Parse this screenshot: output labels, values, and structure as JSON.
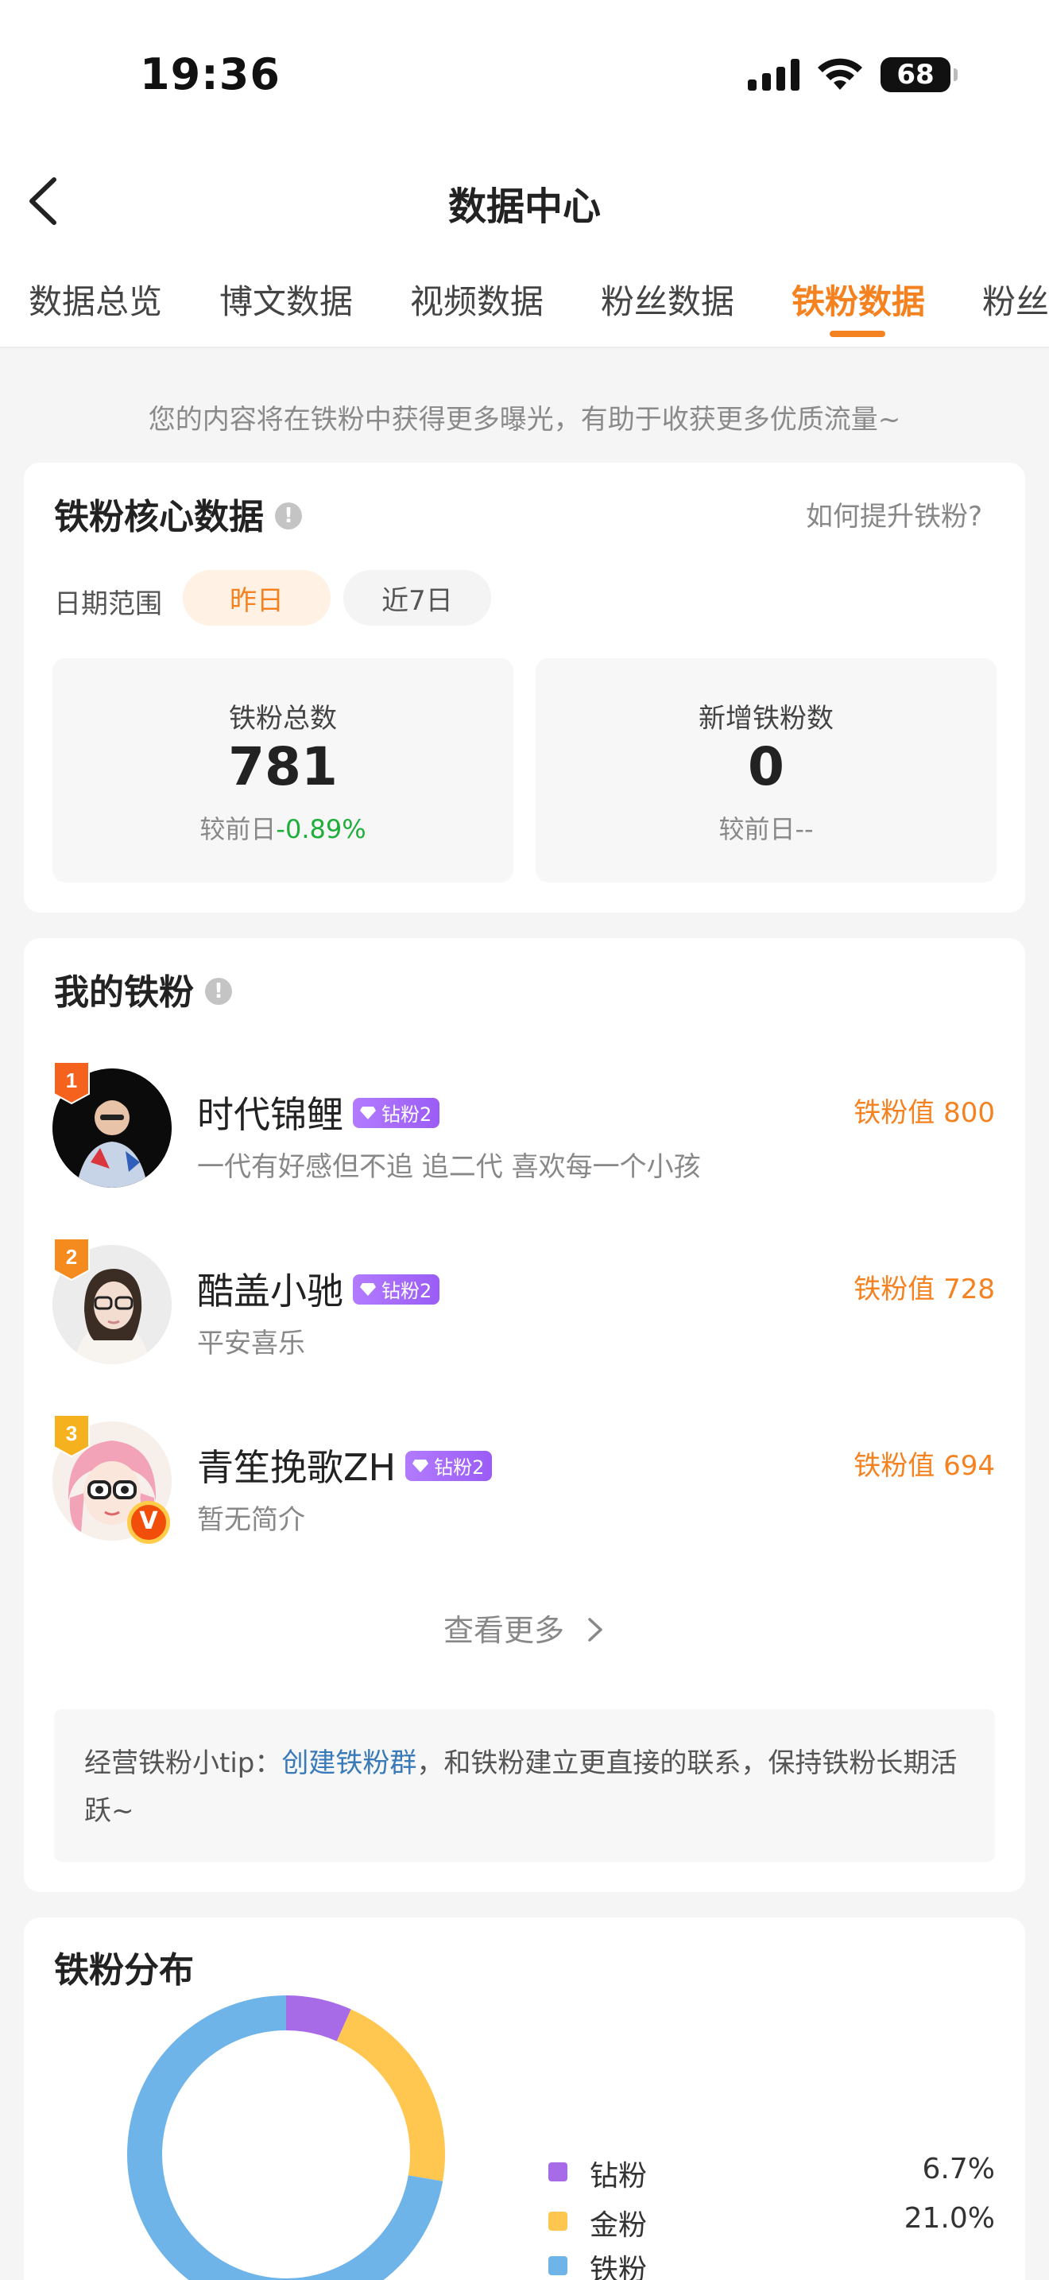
{
  "status_bar": {
    "time": "19:36",
    "battery": "68"
  },
  "nav": {
    "title": "数据中心"
  },
  "tabs": [
    {
      "label": "数据总览",
      "active": false
    },
    {
      "label": "博文数据",
      "active": false
    },
    {
      "label": "视频数据",
      "active": false
    },
    {
      "label": "粉丝数据",
      "active": false
    },
    {
      "label": "铁粉数据",
      "active": true
    },
    {
      "label": "粉丝",
      "active": false
    }
  ],
  "hint": "您的内容将在铁粉中获得更多曝光，有助于收获更多优质流量~",
  "core_data": {
    "title": "铁粉核心数据",
    "how_to_link": "如何提升铁粉?",
    "date_range_label": "日期范围",
    "date_options": [
      "昨日",
      "近7日"
    ],
    "stats": [
      {
        "label": "铁粉总数",
        "value": "781",
        "compare_prefix": "较前日",
        "compare_value": "-0.89%"
      },
      {
        "label": "新增铁粉数",
        "value": "0",
        "compare_prefix": "较前日",
        "compare_value": "--"
      }
    ]
  },
  "my_fans": {
    "title": "我的铁粉",
    "badge_label": "钻粉2",
    "items": [
      {
        "rank": "1",
        "name": "时代锦鲤",
        "bio": "一代有好感但不追 追二代 喜欢每一个小孩",
        "score": "铁粉值 800"
      },
      {
        "rank": "2",
        "name": "酷盖小驰",
        "bio": "平安喜乐",
        "score": "铁粉值 728"
      },
      {
        "rank": "3",
        "name": "青笙挽歌ZH",
        "bio": "暂无简介",
        "score": "铁粉值 694"
      }
    ],
    "more": "查看更多",
    "tip_prefix": "经营铁粉小tip：",
    "tip_link": "创建铁粉群",
    "tip_suffix": "，和铁粉建立更直接的联系，保持铁粉长期活跃~"
  },
  "distribution": {
    "title": "铁粉分布",
    "legend": [
      {
        "label": "钻粉",
        "value": "6.7%",
        "color": "#a86be8"
      },
      {
        "label": "金粉",
        "value": "21.0%",
        "color": "#ffc74f"
      },
      {
        "label": "铁粉",
        "value": "",
        "color": "#6fb4e8"
      }
    ]
  },
  "chart_data": {
    "type": "pie",
    "title": "铁粉分布",
    "categories": [
      "钻粉",
      "金粉",
      "铁粉"
    ],
    "values": [
      6.7,
      21.0,
      72.3
    ],
    "colors": [
      "#a86be8",
      "#ffc74f",
      "#6fb4e8"
    ]
  }
}
